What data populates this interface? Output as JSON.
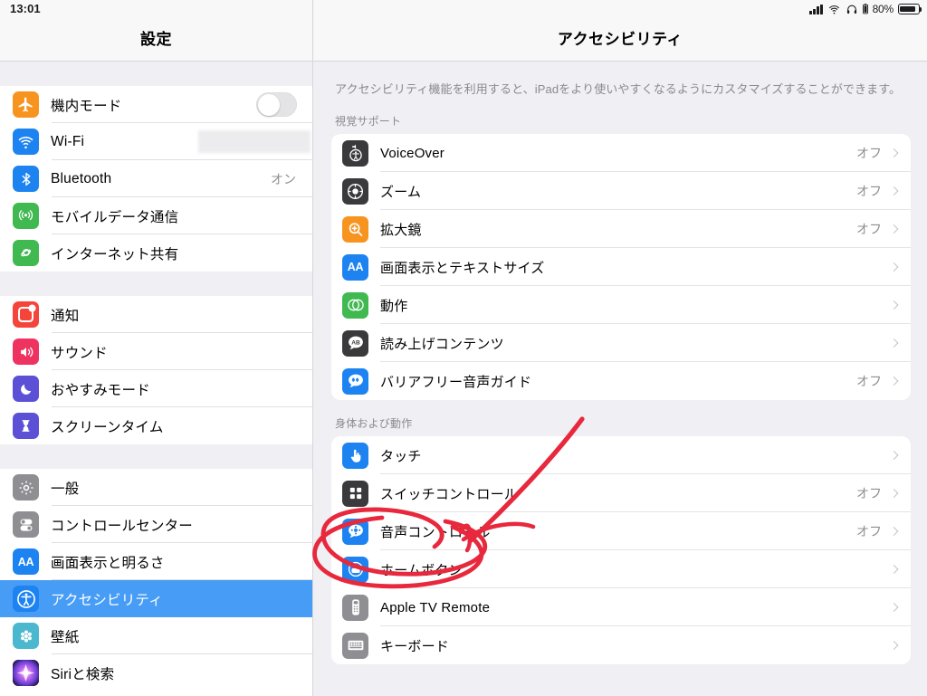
{
  "status_bar": {
    "time": "13:01",
    "battery_percent": "80%",
    "icons": [
      "cellular-signal-icon",
      "wifi-icon",
      "headphones-icon",
      "battery-small-icon",
      "battery-icon"
    ]
  },
  "sidebar": {
    "title": "設定",
    "groups": [
      {
        "rows": [
          {
            "label": "機内モード",
            "icon": "airplane-icon",
            "accessory": "toggle",
            "toggle_on": false,
            "value": ""
          },
          {
            "label": "Wi-Fi",
            "icon": "wifi-icon",
            "accessory": "redacted",
            "value": ""
          },
          {
            "label": "Bluetooth",
            "icon": "bluetooth-icon",
            "accessory": "value",
            "value": "オン"
          },
          {
            "label": "モバイルデータ通信",
            "icon": "cellular-icon",
            "accessory": "none",
            "value": ""
          },
          {
            "label": "インターネット共有",
            "icon": "hotspot-icon",
            "accessory": "none",
            "value": ""
          }
        ]
      },
      {
        "rows": [
          {
            "label": "通知",
            "icon": "notifications-icon",
            "accessory": "none",
            "value": ""
          },
          {
            "label": "サウンド",
            "icon": "sound-icon",
            "accessory": "none",
            "value": ""
          },
          {
            "label": "おやすみモード",
            "icon": "moon-icon",
            "accessory": "none",
            "value": ""
          },
          {
            "label": "スクリーンタイム",
            "icon": "hourglass-icon",
            "accessory": "none",
            "value": ""
          }
        ]
      },
      {
        "rows": [
          {
            "label": "一般",
            "icon": "gear-icon",
            "accessory": "none",
            "value": ""
          },
          {
            "label": "コントロールセンター",
            "icon": "control-center-icon",
            "accessory": "none",
            "value": ""
          },
          {
            "label": "画面表示と明るさ",
            "icon": "display-brightness-icon",
            "accessory": "none",
            "value": ""
          },
          {
            "label": "アクセシビリティ",
            "icon": "accessibility-icon",
            "accessory": "none",
            "value": "",
            "selected": true
          },
          {
            "label": "壁紙",
            "icon": "wallpaper-icon",
            "accessory": "none",
            "value": ""
          },
          {
            "label": "Siriと検索",
            "icon": "siri-icon",
            "accessory": "none",
            "value": ""
          }
        ]
      }
    ]
  },
  "detail": {
    "title": "アクセシビリティ",
    "intro": "アクセシビリティ機能を利用すると、iPadをより使いやすくなるようにカスタマイズすることができます。",
    "sections": [
      {
        "header": "視覚サポート",
        "rows": [
          {
            "label": "VoiceOver",
            "icon": "voiceover-icon",
            "value": "オフ"
          },
          {
            "label": "ズーム",
            "icon": "zoom-icon",
            "value": "オフ"
          },
          {
            "label": "拡大鏡",
            "icon": "magnifier-icon",
            "value": "オフ"
          },
          {
            "label": "画面表示とテキストサイズ",
            "icon": "text-size-icon",
            "value": ""
          },
          {
            "label": "動作",
            "icon": "motion-icon",
            "value": ""
          },
          {
            "label": "読み上げコンテンツ",
            "icon": "spoken-content-icon",
            "value": ""
          },
          {
            "label": "バリアフリー音声ガイド",
            "icon": "audio-descriptions-icon",
            "value": "オフ"
          }
        ]
      },
      {
        "header": "身体および動作",
        "rows": [
          {
            "label": "タッチ",
            "icon": "touch-icon",
            "value": ""
          },
          {
            "label": "スイッチコントロール",
            "icon": "switch-control-icon",
            "value": "オフ"
          },
          {
            "label": "音声コントロール",
            "icon": "voice-control-icon",
            "value": "オフ"
          },
          {
            "label": "ホームボタン",
            "icon": "home-button-icon",
            "value": "",
            "annotated": true
          },
          {
            "label": "Apple TV Remote",
            "icon": "apple-tv-remote-icon",
            "value": ""
          },
          {
            "label": "キーボード",
            "icon": "keyboard-icon",
            "value": ""
          }
        ]
      }
    ]
  },
  "annotation": {
    "name": "red-circle-highlight",
    "color": "#e8283c",
    "target_label": "ホームボタン"
  }
}
